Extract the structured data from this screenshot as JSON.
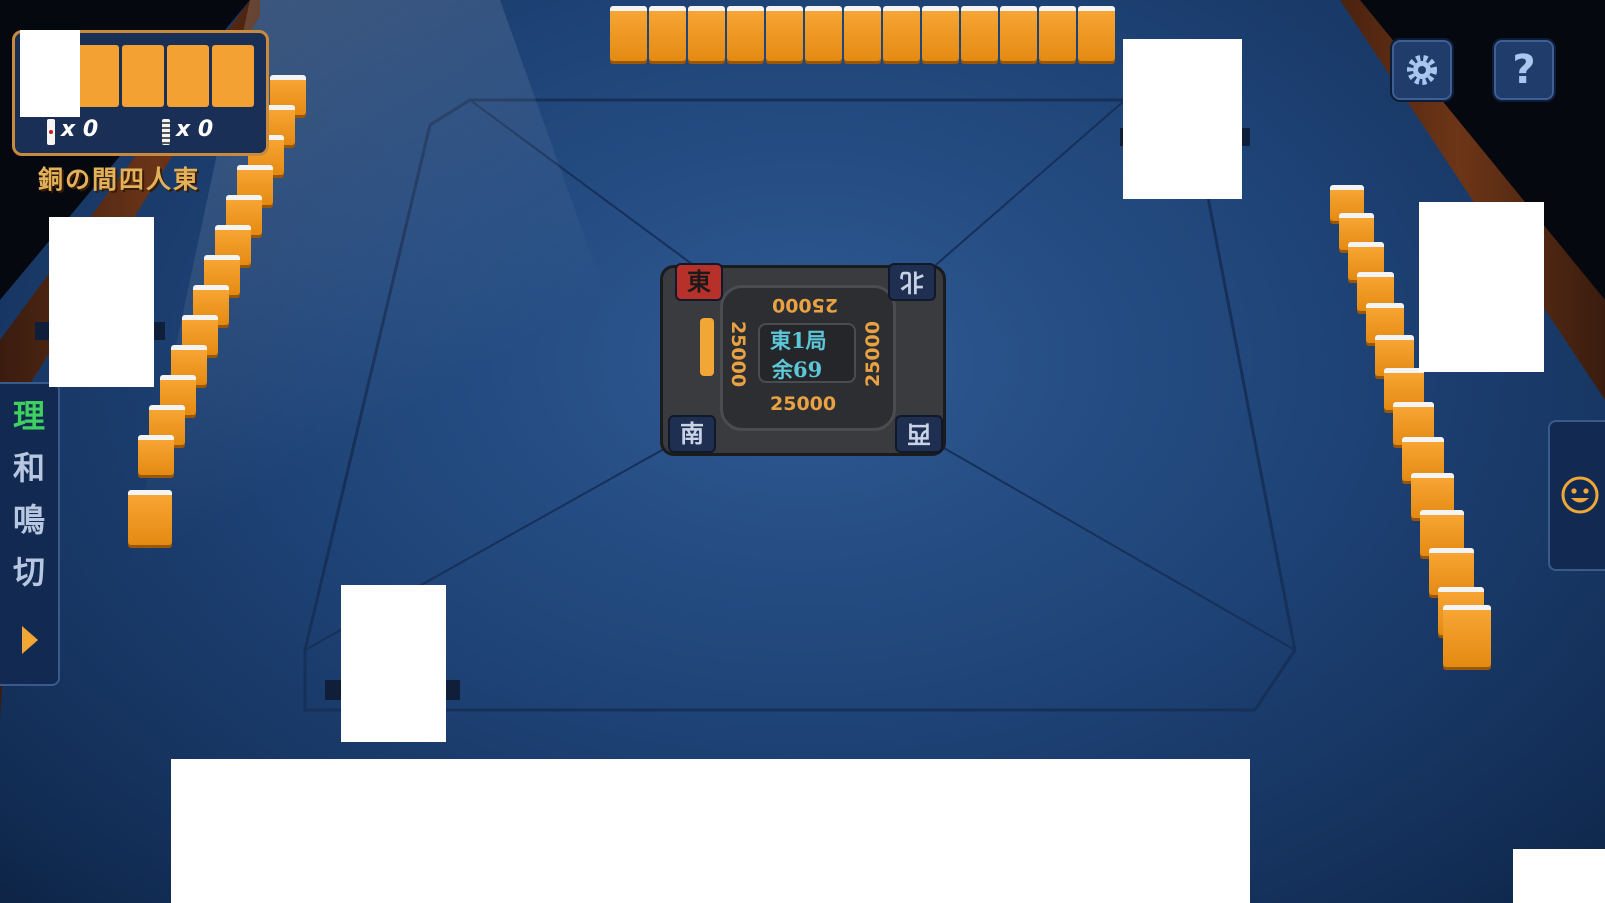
{
  "hud": {
    "riichi_stick_count": "x 0",
    "hundred_stick_count": "x 0",
    "room_name": "銅の間四人東"
  },
  "buttons": {
    "settings_icon": "gear-icon",
    "help_label": "?",
    "emote_icon": "smiley-icon"
  },
  "auto_panel": {
    "options": [
      "理",
      "和",
      "鳴",
      "切"
    ],
    "expand_icon": "triangle-right-icon"
  },
  "center_board": {
    "winds": {
      "self": "東",
      "right": "北",
      "top": "西",
      "left": "南"
    },
    "scores": {
      "top": "25000",
      "left": "25000",
      "right": "25000",
      "bottom": "25000"
    },
    "round_label": "東1局",
    "remaining_label": "余69"
  },
  "colors": {
    "tile_back": "#f2a132",
    "felt": "#1f4478",
    "score_text": "#e8a243",
    "round_text": "#5dc6d8",
    "dealer_wind_bg": "#b7312a"
  }
}
